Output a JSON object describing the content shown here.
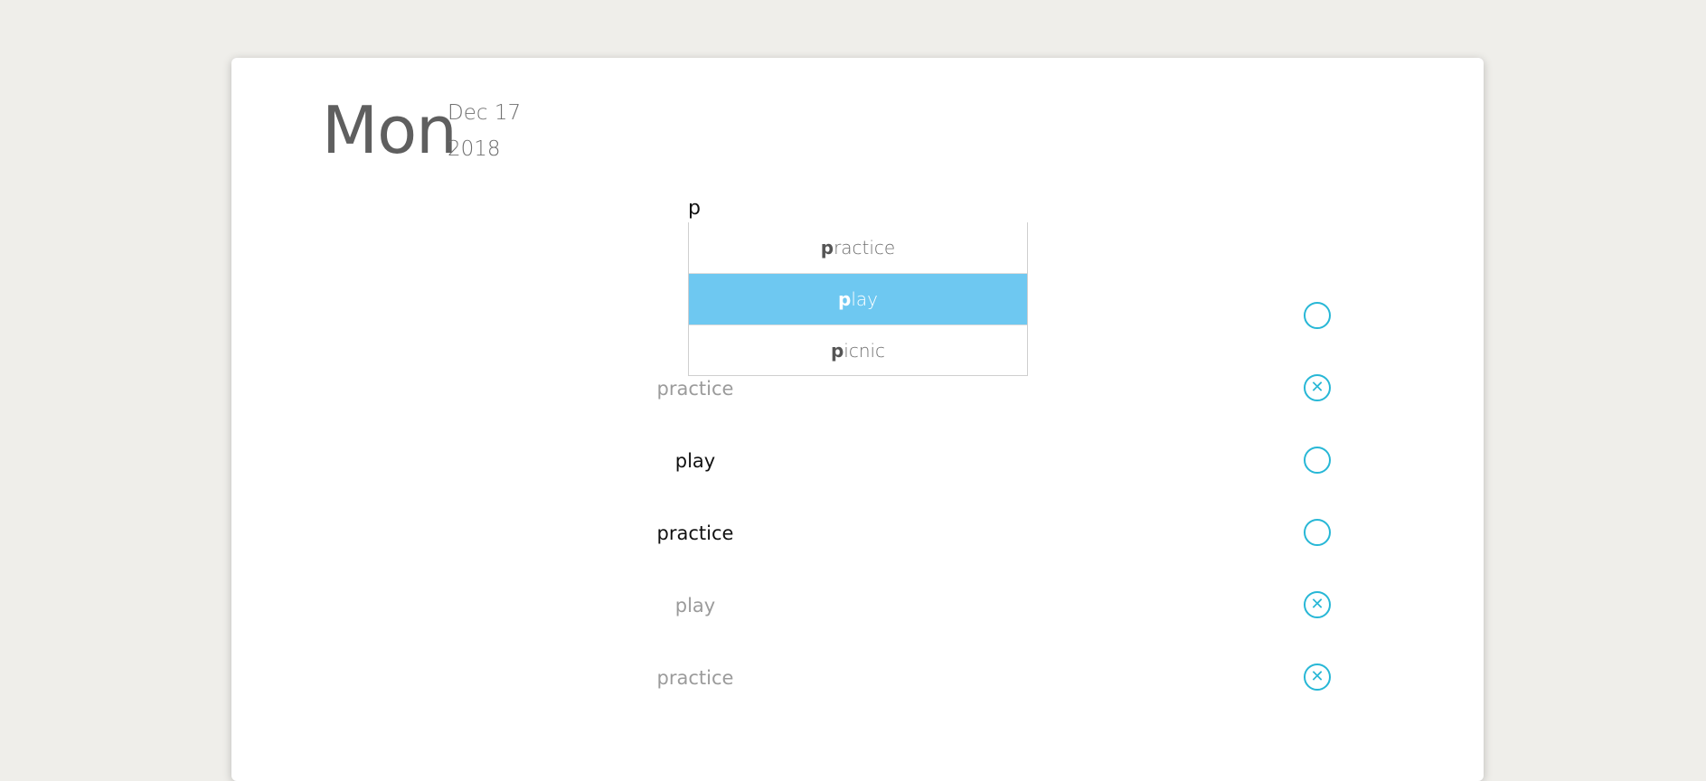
{
  "header": {
    "day": "Mon",
    "month_day": "Dec 17",
    "year": "2018"
  },
  "search": {
    "value": "p"
  },
  "suggestions": [
    {
      "match": "p",
      "rest": "ractice",
      "active": false
    },
    {
      "match": "p",
      "rest": "lay",
      "active": true
    },
    {
      "match": "p",
      "rest": "icnic",
      "active": false
    }
  ],
  "tasks": [
    {
      "label": "practice",
      "done": true
    },
    {
      "label": "play",
      "done": false
    },
    {
      "label": "practice",
      "done": false
    },
    {
      "label": "play",
      "done": true
    },
    {
      "label": "practice",
      "done": true
    }
  ],
  "icons": {
    "open": "circle-icon",
    "done": "x-circle-icon"
  },
  "colors": {
    "accent": "#27b7d6",
    "highlight": "#6ec8f1",
    "background": "#efeeea"
  }
}
